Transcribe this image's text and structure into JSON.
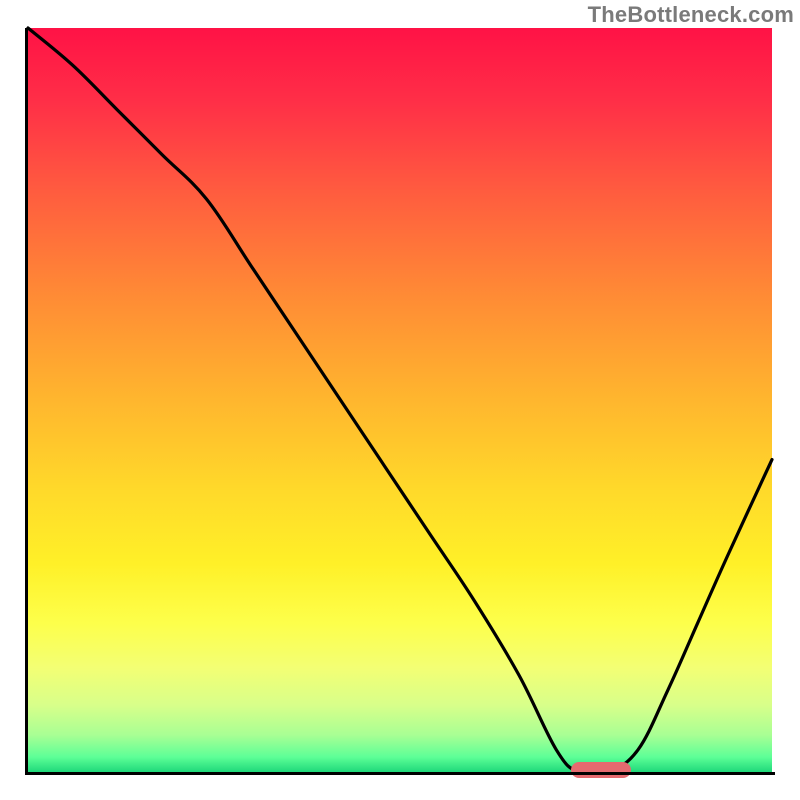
{
  "watermark": "TheBottleneck.com",
  "chart_data": {
    "type": "line",
    "title": "",
    "xlabel": "",
    "ylabel": "",
    "xlim": [
      0,
      100
    ],
    "ylim": [
      0,
      100
    ],
    "axes_visible": {
      "ticks": false,
      "labels": false,
      "spines": [
        "left",
        "bottom"
      ]
    },
    "background": {
      "style": "vertical-gradient",
      "stops": [
        {
          "pos": 0.0,
          "color": "#ff1246"
        },
        {
          "pos": 0.5,
          "color": "#ffb62e"
        },
        {
          "pos": 0.8,
          "color": "#fdff4b"
        },
        {
          "pos": 1.0,
          "color": "#1fd87a"
        }
      ]
    },
    "series": [
      {
        "name": "bottleneck-curve",
        "color": "#000000",
        "x": [
          0,
          6,
          12,
          18,
          24,
          30,
          36,
          42,
          48,
          54,
          60,
          66,
          71,
          74,
          78,
          82,
          86,
          90,
          94,
          100
        ],
        "y": [
          100,
          95,
          89,
          83,
          77,
          68,
          59,
          50,
          41,
          32,
          23,
          13,
          3,
          0,
          0,
          3,
          11,
          20,
          29,
          42
        ]
      }
    ],
    "marker": {
      "name": "optimal-range",
      "color": "#e56a6f",
      "shape": "rounded-bar",
      "x_range": [
        73,
        81
      ],
      "y": 0
    }
  }
}
